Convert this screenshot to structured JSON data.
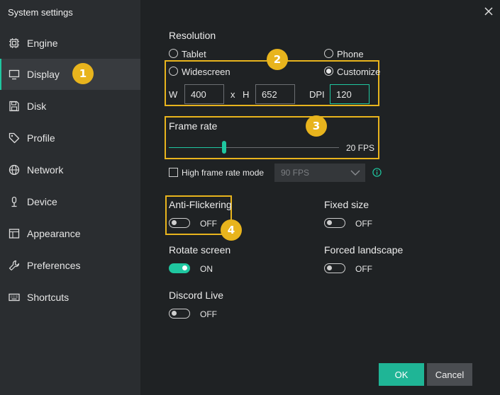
{
  "window": {
    "title": "System settings"
  },
  "colors": {
    "accent": "#1fc7a0",
    "highlight": "#e8b41d",
    "sidebar": "#2a2d30",
    "content": "#1f2224"
  },
  "sidebar": {
    "items": [
      {
        "label": "Engine",
        "icon": "chip-icon"
      },
      {
        "label": "Display",
        "icon": "monitor-icon",
        "active": true
      },
      {
        "label": "Disk",
        "icon": "disk-icon"
      },
      {
        "label": "Profile",
        "icon": "tag-icon"
      },
      {
        "label": "Network",
        "icon": "globe-icon"
      },
      {
        "label": "Device",
        "icon": "mic-icon"
      },
      {
        "label": "Appearance",
        "icon": "window-icon"
      },
      {
        "label": "Preferences",
        "icon": "wrench-icon"
      },
      {
        "label": "Shortcuts",
        "icon": "keyboard-icon"
      }
    ]
  },
  "badges": [
    "1",
    "2",
    "3",
    "4"
  ],
  "resolution": {
    "title": "Resolution",
    "options": [
      {
        "label": "Tablet",
        "checked": false
      },
      {
        "label": "Phone",
        "checked": false
      },
      {
        "label": "Widescreen",
        "checked": false
      },
      {
        "label": "Customize",
        "checked": true
      }
    ],
    "w_label": "W",
    "w_value": "400",
    "x_label": "x",
    "h_label": "H",
    "h_value": "652",
    "dpi_label": "DPI",
    "dpi_value": "120"
  },
  "frame_rate": {
    "title": "Frame rate",
    "value": 20,
    "value_text": "20 FPS",
    "high_mode_label": "High frame rate mode",
    "high_mode_checked": false,
    "high_mode_select": "90 FPS"
  },
  "toggles": {
    "anti_flickering": {
      "label": "Anti-Flickering",
      "state": "OFF"
    },
    "fixed_size": {
      "label": "Fixed size",
      "state": "OFF"
    },
    "rotate_screen": {
      "label": "Rotate screen",
      "state": "ON"
    },
    "forced_landscape": {
      "label": "Forced landscape",
      "state": "OFF"
    },
    "discord_live": {
      "label": "Discord Live",
      "state": "OFF"
    }
  },
  "footer": {
    "ok_label": "OK",
    "cancel_label": "Cancel"
  }
}
